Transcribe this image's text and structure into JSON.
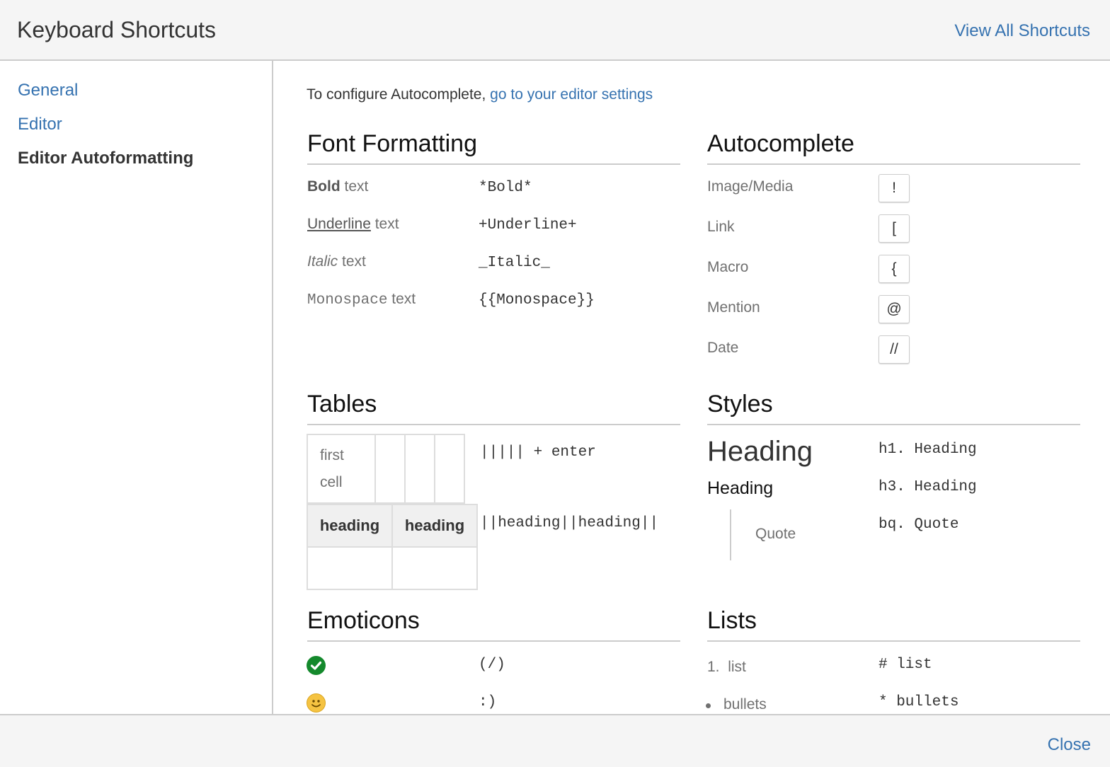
{
  "header": {
    "title": "Keyboard Shortcuts",
    "view_all": "View All Shortcuts"
  },
  "sidebar": {
    "items": [
      {
        "label": "General",
        "active": false
      },
      {
        "label": "Editor",
        "active": false
      },
      {
        "label": "Editor Autoformatting",
        "active": true
      }
    ]
  },
  "intro": {
    "text": "To configure Autocomplete, ",
    "link": "go to your editor settings"
  },
  "font_formatting": {
    "title": "Font Formatting",
    "rows": [
      {
        "styled": "Bold",
        "suffix": " text",
        "syntax": "*Bold*"
      },
      {
        "styled": "Underline",
        "suffix": " text",
        "syntax": "+Underline+"
      },
      {
        "styled": "Italic",
        "suffix": " text",
        "syntax": "_Italic_"
      },
      {
        "styled": "Monospace",
        "suffix": " text",
        "syntax": "{{Monospace}}"
      }
    ]
  },
  "autocomplete": {
    "title": "Autocomplete",
    "rows": [
      {
        "label": "Image/Media",
        "key": "!"
      },
      {
        "label": "Link",
        "key": "["
      },
      {
        "label": "Macro",
        "key": "{"
      },
      {
        "label": "Mention",
        "key": "@"
      },
      {
        "label": "Date",
        "key": "//"
      }
    ]
  },
  "tables": {
    "title": "Tables",
    "first_cell_line1": "first",
    "first_cell_line2": "cell",
    "table_syntax": "||||| + enter",
    "heading1": "heading",
    "heading2": "heading",
    "heading_syntax": "||heading||heading||"
  },
  "styles": {
    "title": "Styles",
    "h1_label": "Heading",
    "h1_syntax": "h1. Heading",
    "h3_label": "Heading",
    "h3_syntax": "h3. Heading",
    "quote_label": "Quote",
    "quote_syntax": "bq. Quote"
  },
  "emoticons": {
    "title": "Emoticons",
    "rows": [
      {
        "icon": "check-emoticon-icon",
        "syntax": "(/)",
        "color": "#14892c"
      },
      {
        "icon": "smile-emoticon-icon",
        "syntax": ":)",
        "color": "#f5c342"
      }
    ]
  },
  "lists": {
    "title": "Lists",
    "numbered_marker": "1.",
    "numbered_label": "list",
    "numbered_syntax": "# list",
    "bullet_label": "bullets",
    "bullet_syntax": "* bullets"
  },
  "footer": {
    "close": "Close"
  },
  "colors": {
    "link": "#3572b0",
    "text": "#333333",
    "muted": "#707070",
    "border": "#cccccc"
  }
}
